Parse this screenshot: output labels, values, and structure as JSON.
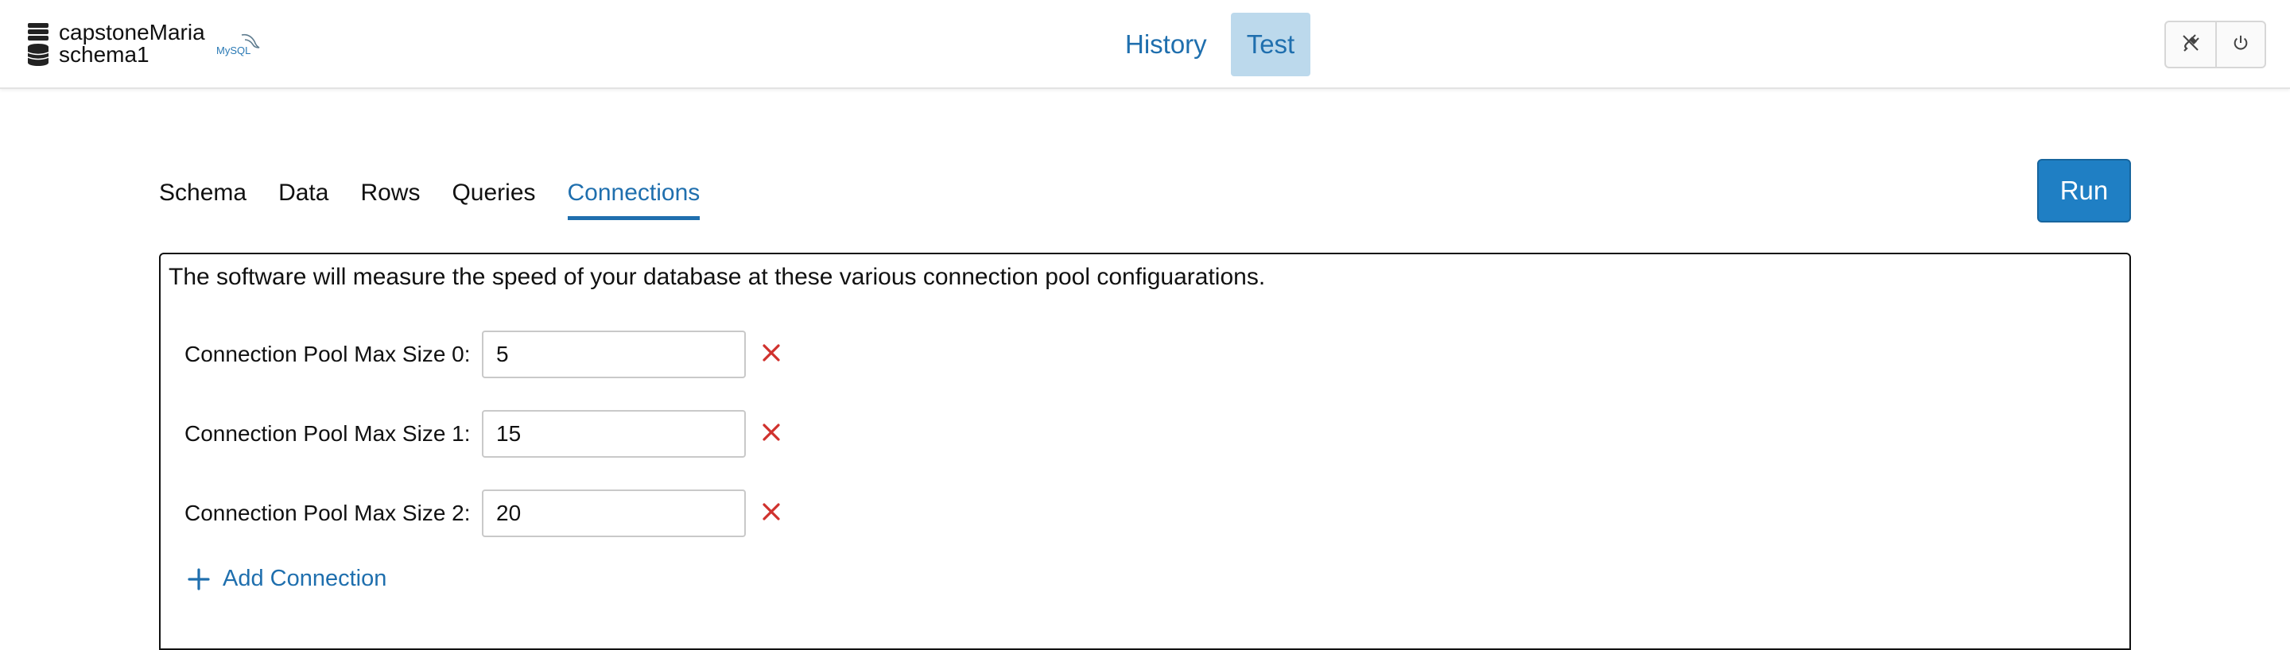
{
  "header": {
    "database_name": "capstoneMaria",
    "schema_name": "schema1",
    "db_logo_text": "MySQL",
    "mode_tabs": [
      {
        "label": "History",
        "active": false
      },
      {
        "label": "Test",
        "active": true
      }
    ],
    "tools": [
      {
        "icon": "disconnect-plug-icon"
      },
      {
        "icon": "power-icon"
      }
    ]
  },
  "section_tabs": [
    {
      "label": "Schema",
      "active": false
    },
    {
      "label": "Data",
      "active": false
    },
    {
      "label": "Rows",
      "active": false
    },
    {
      "label": "Queries",
      "active": false
    },
    {
      "label": "Connections",
      "active": true
    }
  ],
  "run_label": "Run",
  "connections": {
    "description": "The software will measure the speed of your database at these various connection pool configuarations.",
    "rows": [
      {
        "label": "Connection Pool Max Size 0:",
        "value": "5"
      },
      {
        "label": "Connection Pool Max Size 1:",
        "value": "15"
      },
      {
        "label": "Connection Pool Max Size 2:",
        "value": "20"
      }
    ],
    "add_label": "Add Connection"
  },
  "colors": {
    "accent": "#1f6fae",
    "run_button": "#1f7fc4",
    "active_mode_tab": "#bcd9ec",
    "remove_icon": "#d0312d"
  }
}
